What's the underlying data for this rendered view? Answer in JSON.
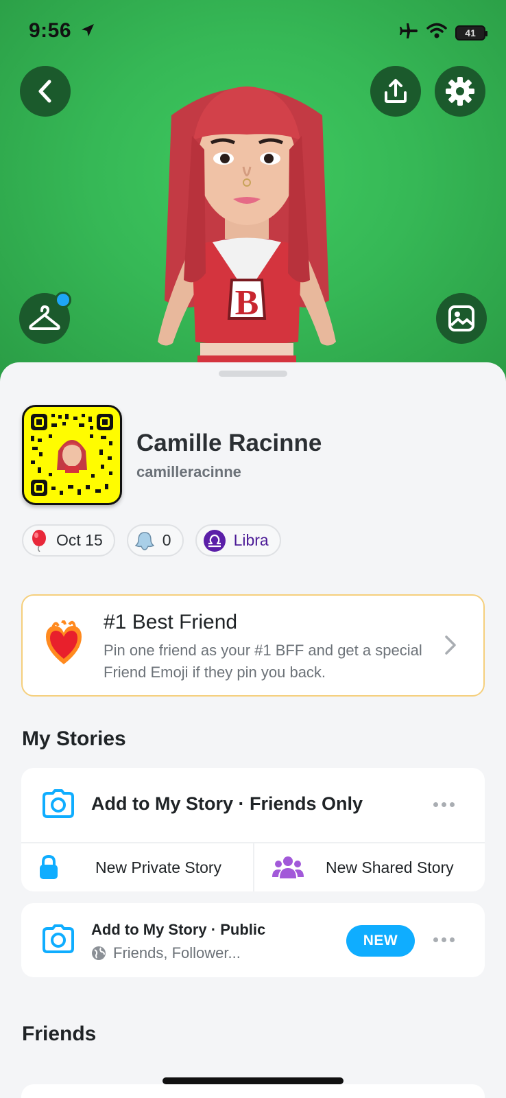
{
  "status_bar": {
    "time": "9:56",
    "battery": "41"
  },
  "profile": {
    "display_name": "Camille Racinne",
    "username": "camilleracinne"
  },
  "chips": [
    {
      "icon": "balloon-icon",
      "label": "Oct 15"
    },
    {
      "icon": "ghost-icon",
      "label": "0"
    },
    {
      "icon": "libra-icon",
      "label": "Libra"
    }
  ],
  "bff_card": {
    "title": "#1 Best Friend",
    "description": "Pin one friend as your #1 BFF and get a special Friend Emoji if they pin you back."
  },
  "my_stories": {
    "section_title": "My Stories",
    "add_friends_only": "Add to My Story · Friends Only",
    "new_private": "New Private Story",
    "new_shared": "New Shared Story",
    "add_public": "Add to My Story · Public",
    "public_audience": "Friends, Follower...",
    "new_badge": "NEW"
  },
  "friends": {
    "section_title": "Friends"
  },
  "colors": {
    "hero_green": "#36b856",
    "snapcode_yellow": "#fffc00",
    "accent_blue": "#0fadff",
    "libra_purple": "#5b1fa8"
  }
}
